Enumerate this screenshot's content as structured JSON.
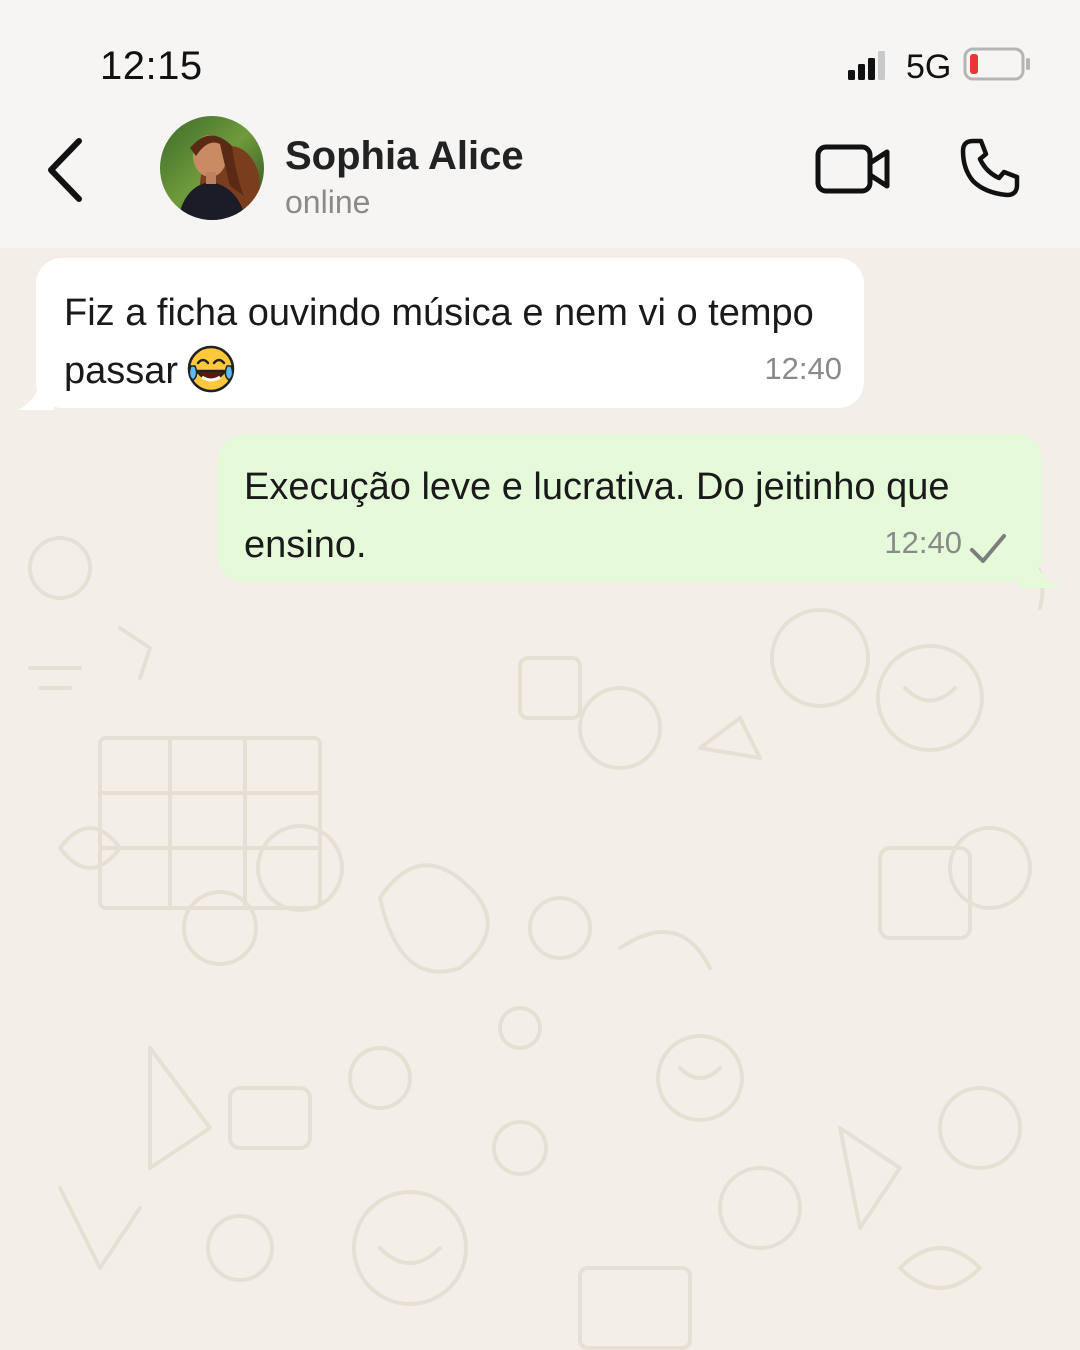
{
  "status_bar": {
    "time": "12:15",
    "network": "5G",
    "battery_color": "#e53935"
  },
  "header": {
    "back_icon": "chevron-left-icon",
    "contact_name": "Sophia Alice",
    "contact_status": "online",
    "video_icon": "video-camera-icon",
    "phone_icon": "phone-icon"
  },
  "messages": [
    {
      "direction": "incoming",
      "text": "Fiz a ficha ouvindo música e nem vi o tempo passar",
      "emoji": "face-with-tears-of-joy",
      "time": "12:40"
    },
    {
      "direction": "outgoing",
      "text": "Execução leve e lucrativa. Do jeitinho que ensino.",
      "time": "12:40",
      "status": "sent-check"
    }
  ],
  "colors": {
    "incoming_bubble": "#ffffff",
    "outgoing_bubble": "#e4fad8",
    "chat_background": "#f3efe8",
    "header_background": "#f6f5f3"
  }
}
